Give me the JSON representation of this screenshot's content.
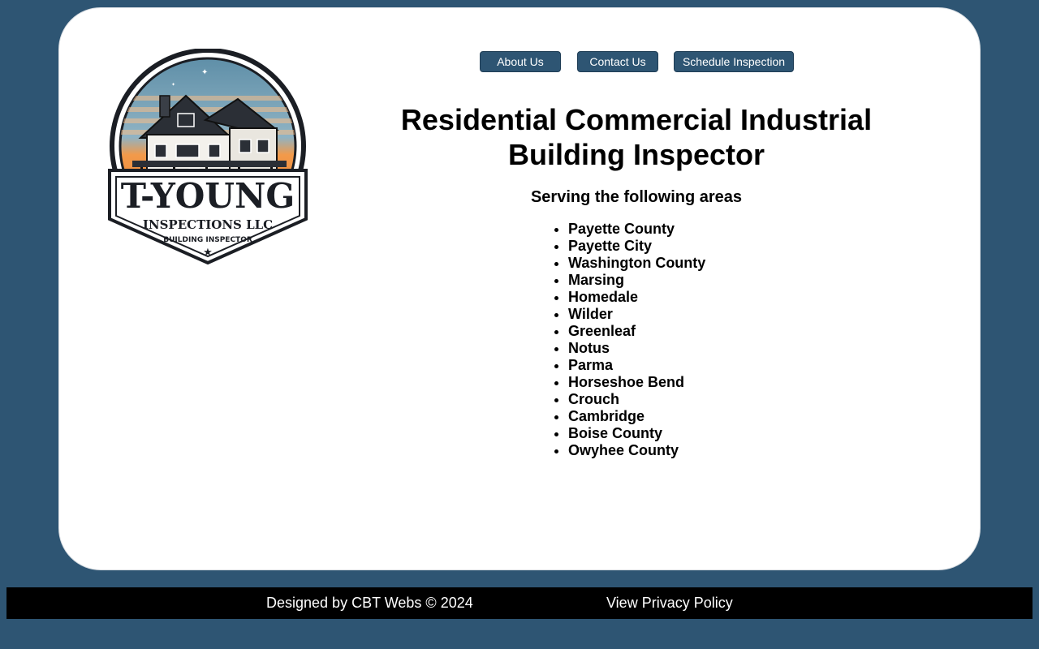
{
  "logo": {
    "brand_main": "T-YOUNG",
    "brand_sub": "INSPECTIONS LLC",
    "brand_tagline": "BUILDING INSPECTOR",
    "icon": "house-logo"
  },
  "nav": {
    "about_label": "About Us",
    "contact_label": "Contact Us",
    "schedule_label": "Schedule Inspection"
  },
  "main": {
    "headline_line1": "Residential Commercial Industrial",
    "headline_line2": "Building Inspector",
    "subheading": "Serving the following areas",
    "areas": [
      "Payette County",
      "Payette City",
      "Washington County",
      "Marsing",
      "Homedale",
      "Wilder",
      "Greenleaf",
      "Notus",
      "Parma",
      "Horseshoe Bend",
      "Crouch",
      "Cambridge",
      "Boise County",
      "Owyhee County"
    ]
  },
  "footer": {
    "credit": "Designed by CBT Webs © 2024",
    "privacy_label": "View Privacy Policy"
  },
  "colors": {
    "page_background": "#2e5573",
    "card_background": "#ffffff",
    "button_background": "#2e5573",
    "footer_background": "#000000",
    "logo_orange": "#e8722a",
    "logo_dark": "#1b1e24"
  }
}
